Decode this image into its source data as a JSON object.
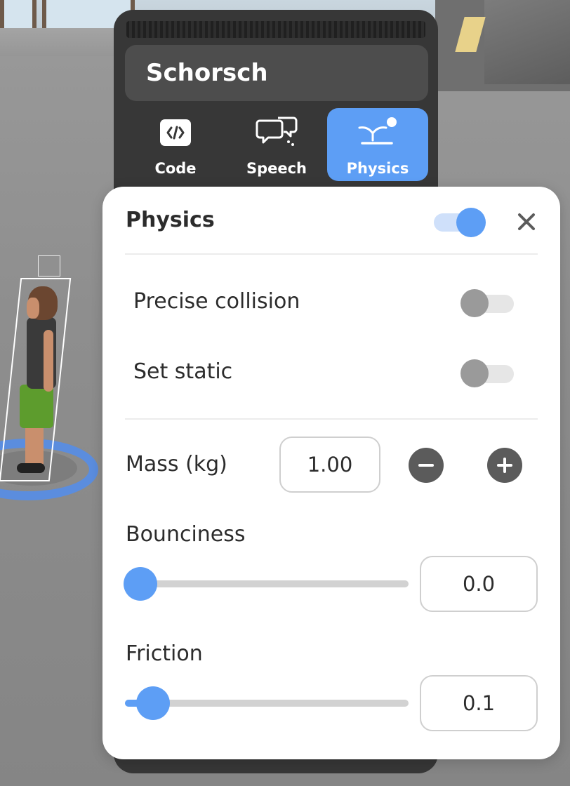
{
  "object": {
    "name": "Schorsch"
  },
  "tabs": [
    {
      "label": "Code",
      "icon": "code-icon",
      "active": false
    },
    {
      "label": "Speech",
      "icon": "speech-bubbles-icon",
      "active": false
    },
    {
      "label": "Physics",
      "icon": "physics-bounce-icon",
      "active": true
    }
  ],
  "physics": {
    "title": "Physics",
    "enabled": true,
    "precise_collision": {
      "label": "Precise collision",
      "on": false
    },
    "set_static": {
      "label": "Set static",
      "on": false
    },
    "mass": {
      "label": "Mass (kg)",
      "value": "1.00"
    },
    "bounciness": {
      "label": "Bounciness",
      "value": "0.0",
      "fraction": 0.0
    },
    "friction": {
      "label": "Friction",
      "value": "0.1",
      "fraction": 0.1
    }
  },
  "colors": {
    "accent": "#5d9ef5",
    "panel": "#373737",
    "selection_ring": "#5b8dde"
  }
}
